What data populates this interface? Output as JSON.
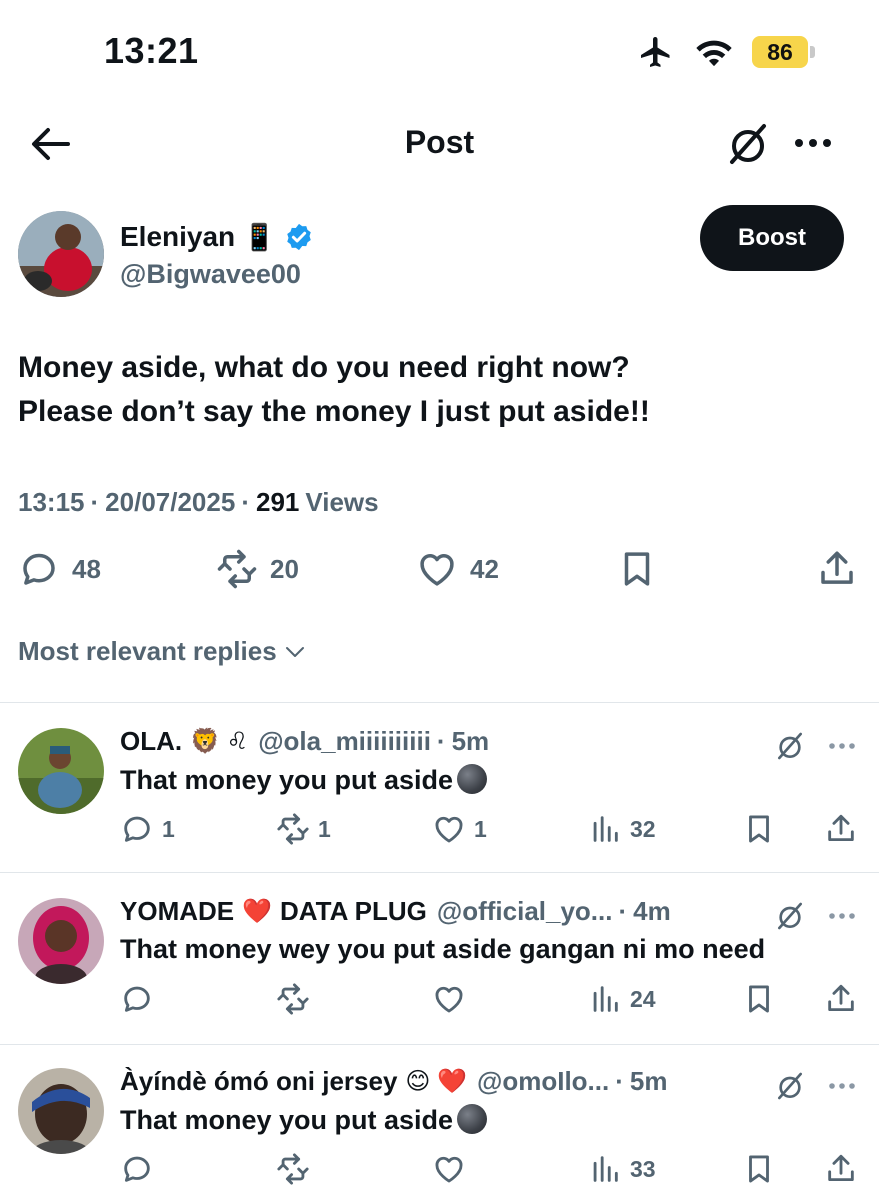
{
  "status_bar": {
    "time": "13:21",
    "battery": "86"
  },
  "nav": {
    "title": "Post"
  },
  "author": {
    "name": "Eleniyan",
    "emoji": "📱",
    "handle": "@Bigwavee00",
    "boost_label": "Boost"
  },
  "post": {
    "line1": "Money aside, what do you need right now?",
    "line2": "Please don’t say the money I just put aside!!",
    "time": "13:15",
    "date": "20/07/2025",
    "views_count": "291",
    "views_label": "Views",
    "replies": "48",
    "reposts": "20",
    "likes": "42"
  },
  "replies_sort": "Most relevant replies",
  "replies": [
    {
      "name": "OLA.",
      "emoji": "🦁 ♌",
      "handle": "@ola_miiiiiiiiii",
      "time": "5m",
      "text": "That money you put aside",
      "replies": "1",
      "reposts": "1",
      "likes": "1",
      "views": "32"
    },
    {
      "name": "YOMADE",
      "emoji": "❤️",
      "name2": "DATA PLUG",
      "handle": "@official_yo...",
      "time": "4m",
      "text": "That money wey you put aside gangan ni mo need",
      "replies": "",
      "reposts": "",
      "likes": "",
      "views": "24"
    },
    {
      "name": "Àyíndè ómó oni jersey",
      "emoji": "😊 ❤️",
      "handle": "@omoIlo...",
      "time": "5m",
      "text": "That money you put aside",
      "replies": "",
      "reposts": "",
      "likes": "",
      "views": "33"
    }
  ],
  "colors": {
    "text": "#0f1419",
    "secondary": "#536471",
    "verified": "#1d9bf0",
    "battery": "#f7d54b"
  }
}
